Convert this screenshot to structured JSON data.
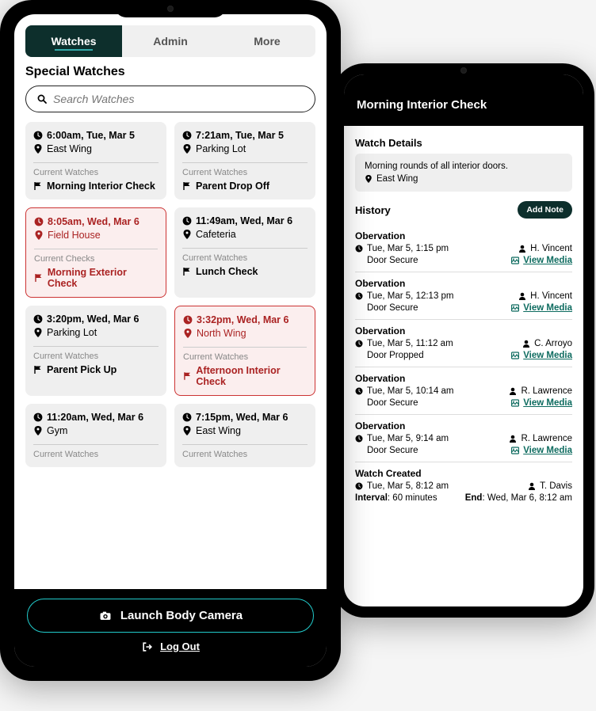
{
  "tabs": [
    "Watches",
    "Admin",
    "More"
  ],
  "section_title": "Special Watches",
  "search_placeholder": "Search Watches",
  "cards": [
    {
      "time": "6:00am, Tue, Mar 5",
      "place": "East Wing",
      "label": "Current Watches",
      "name": "Morning Interior Check",
      "alert": false
    },
    {
      "time": "7:21am, Tue, Mar 5",
      "place": "Parking Lot",
      "label": "Current Watches",
      "name": "Parent Drop Off",
      "alert": false
    },
    {
      "time": "8:05am, Wed, Mar 6",
      "place": "Field House",
      "label": "Current Checks",
      "name": "Morning Exterior Check",
      "alert": true
    },
    {
      "time": "11:49am, Wed, Mar 6",
      "place": "Cafeteria",
      "label": "Current Watches",
      "name": "Lunch Check",
      "alert": false
    },
    {
      "time": "3:20pm, Wed, Mar 6",
      "place": "Parking Lot",
      "label": "Current Watches",
      "name": "Parent Pick Up",
      "alert": false
    },
    {
      "time": "3:32pm, Wed, Mar 6",
      "place": "North Wing",
      "label": "Current Watches",
      "name": "Afternoon Interior Check",
      "alert": true
    },
    {
      "time": "11:20am, Wed, Mar 6",
      "place": "Gym",
      "label": "Current Watches",
      "name": "",
      "alert": false
    },
    {
      "time": "7:15pm, Wed, Mar 6",
      "place": "East Wing",
      "label": "Current Watches",
      "name": "",
      "alert": false
    }
  ],
  "footer": {
    "launch": "Launch Body Camera",
    "logout": "Log Out"
  },
  "detail": {
    "header": "Morning Interior Check",
    "watch_details_label": "Watch Details",
    "description": "Morning rounds of all interior doors.",
    "location": "East Wing",
    "history_label": "History",
    "add_note": "Add Note",
    "observation_label": "Obervation",
    "view_media": "View Media",
    "entries": [
      {
        "time": "Tue, Mar 5, 1:15 pm",
        "status": "Door Secure",
        "by": "H. Vincent"
      },
      {
        "time": "Tue, Mar 5, 12:13 pm",
        "status": "Door Secure",
        "by": "H. Vincent"
      },
      {
        "time": "Tue, Mar 5, 11:12 am",
        "status": "Door Propped",
        "by": "C. Arroyo"
      },
      {
        "time": "Tue, Mar 5, 10:14 am",
        "status": "Door Secure",
        "by": "R. Lawrence"
      },
      {
        "time": "Tue, Mar 5, 9:14 am",
        "status": "Door Secure",
        "by": "R. Lawrence"
      }
    ],
    "created": {
      "title": "Watch Created",
      "time": "Tue, Mar 5, 8:12 am",
      "by": "T. Davis",
      "interval_label": "Interval",
      "interval_value": "60 minutes",
      "end_label": "End",
      "end_value": "Wed, Mar 6, 8:12 am"
    }
  }
}
